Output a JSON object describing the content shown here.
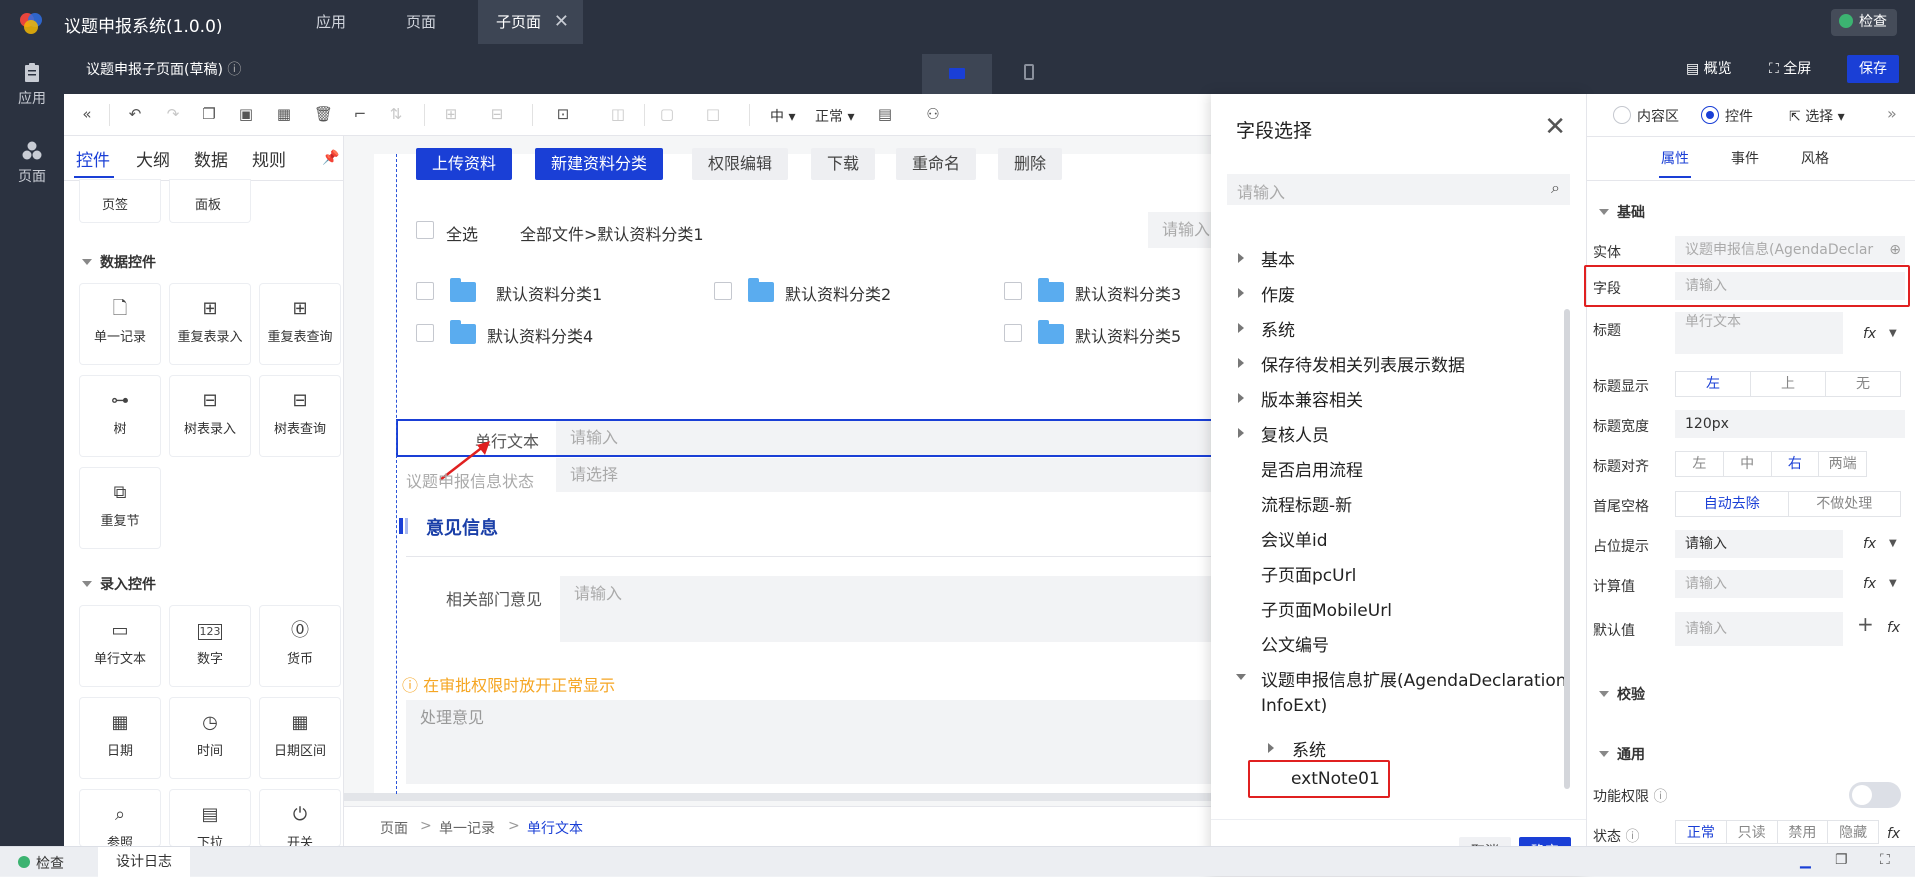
{
  "topbar": {
    "app_title": "议题申报系统(1.0.0)",
    "tabs": [
      {
        "label": "应用"
      },
      {
        "label": "页面"
      },
      {
        "label": "子页面"
      }
    ],
    "check_label": "检查"
  },
  "rail": {
    "items": [
      {
        "label": "应用"
      },
      {
        "label": "页面"
      }
    ]
  },
  "header": {
    "page_name": "议题申报子页面(草稿)",
    "overview": "概览",
    "fullscreen": "全屏",
    "save": "保存"
  },
  "toolbar": {
    "size": "中",
    "style": "正常"
  },
  "left_panel": {
    "tabs": [
      {
        "label": "控件"
      },
      {
        "label": "大纲"
      },
      {
        "label": "数据"
      },
      {
        "label": "规则"
      }
    ],
    "top_items": [
      {
        "label": "页签"
      },
      {
        "label": "面板"
      }
    ],
    "sections": [
      {
        "title": "数据控件",
        "items": [
          {
            "label": "单一记录",
            "icon": "doc-icon"
          },
          {
            "label": "重复表录入",
            "icon": "table-input-icon"
          },
          {
            "label": "重复表查询",
            "icon": "table-query-icon"
          },
          {
            "label": "树",
            "icon": "tree-icon"
          },
          {
            "label": "树表录入",
            "icon": "tree-table-input-icon"
          },
          {
            "label": "树表查询",
            "icon": "tree-table-query-icon"
          },
          {
            "label": "重复节",
            "icon": "repeat-section-icon"
          }
        ]
      },
      {
        "title": "录入控件",
        "items": [
          {
            "label": "单行文本",
            "icon": "textbox-icon"
          },
          {
            "label": "数字",
            "icon": "number-icon"
          },
          {
            "label": "货币",
            "icon": "currency-icon"
          },
          {
            "label": "日期",
            "icon": "calendar-icon"
          },
          {
            "label": "时间",
            "icon": "clock-icon"
          },
          {
            "label": "日期区间",
            "icon": "date-range-icon"
          },
          {
            "label": "参照",
            "icon": "reference-icon"
          },
          {
            "label": "下拉",
            "icon": "dropdown-icon"
          },
          {
            "label": "开关",
            "icon": "power-icon"
          }
        ]
      }
    ]
  },
  "canvas": {
    "buttons": {
      "upload": "上传资料",
      "new_category": "新建资料分类",
      "permission": "权限编辑",
      "download": "下载",
      "rename": "重命名",
      "delete": "删除"
    },
    "select_all": "全选",
    "path": "全部文件>默认资料分类1",
    "search_placeholder": "请输入",
    "folders": [
      {
        "name": "默认资料分类1"
      },
      {
        "name": "默认资料分类2"
      },
      {
        "name": "默认资料分类3"
      },
      {
        "name": "默认资料分类4"
      },
      {
        "name": "默认资料分类5"
      }
    ],
    "field_single_text": {
      "label": "单行文本",
      "placeholder": "请输入"
    },
    "field_status": {
      "label": "议题申报信息状态",
      "placeholder": "请选择"
    },
    "section_title": "意见信息",
    "field_dept": {
      "label": "相关部门意见",
      "placeholder": "请输入"
    },
    "warning": "在审批权限时放开正常显示",
    "handling": "处理意见"
  },
  "breadcrumb": {
    "items": [
      {
        "label": "页面"
      },
      {
        "label": "单一记录"
      },
      {
        "label": "单行文本"
      }
    ]
  },
  "dialog": {
    "title": "字段选择",
    "search_placeholder": "请输入",
    "tree": [
      {
        "label": "基本",
        "expandable": true
      },
      {
        "label": "作废",
        "expandable": true
      },
      {
        "label": "系统",
        "expandable": true
      },
      {
        "label": "保存待发相关列表展示数据",
        "expandable": true
      },
      {
        "label": "版本兼容相关",
        "expandable": true
      },
      {
        "label": "复核人员",
        "expandable": true
      },
      {
        "label": "是否启用流程",
        "expandable": false
      },
      {
        "label": "流程标题-新",
        "expandable": false
      },
      {
        "label": "会议单id",
        "expandable": false
      },
      {
        "label": "子页面pcUrl",
        "expandable": false
      },
      {
        "label": "子页面MobileUrl",
        "expandable": false
      },
      {
        "label": "公文编号",
        "expandable": false
      }
    ],
    "ext_node": {
      "line1": "议题申报信息扩展(AgendaDeclaration",
      "line2": "InfoExt)"
    },
    "ext_children": [
      {
        "label": "系统"
      },
      {
        "label": "extNote01"
      }
    ],
    "cancel": "取消",
    "ok": "确定"
  },
  "right_panel": {
    "mode": {
      "content": "内容区",
      "control": "控件",
      "select": "选择"
    },
    "tabs": [
      {
        "label": "属性"
      },
      {
        "label": "事件"
      },
      {
        "label": "风格"
      }
    ],
    "basic_title": "基础",
    "entity": {
      "label": "实体",
      "value": "议题申报信息(AgendaDeclar"
    },
    "field": {
      "label": "字段",
      "placeholder": "请输入"
    },
    "title": {
      "label": "标题",
      "placeholder": "单行文本"
    },
    "title_display": {
      "label": "标题显示",
      "options": [
        "左",
        "上",
        "无"
      ]
    },
    "title_width": {
      "label": "标题宽度",
      "value": "120px"
    },
    "title_align": {
      "label": "标题对齐",
      "options": [
        "左",
        "中",
        "右",
        "两端"
      ]
    },
    "trim": {
      "label": "首尾空格",
      "options": [
        "自动去除",
        "不做处理"
      ]
    },
    "placeholder": {
      "label": "占位提示",
      "value": "请输入"
    },
    "calc": {
      "label": "计算值",
      "placeholder": "请输入"
    },
    "default": {
      "label": "默认值",
      "placeholder": "请输入"
    },
    "validate_title": "校验",
    "general_title": "通用",
    "permission": {
      "label": "功能权限"
    },
    "state": {
      "label": "状态",
      "options": [
        "正常",
        "只读",
        "禁用",
        "隐藏"
      ]
    },
    "fx": "fx"
  },
  "statusbar": {
    "check": "检查",
    "log": "设计日志"
  }
}
